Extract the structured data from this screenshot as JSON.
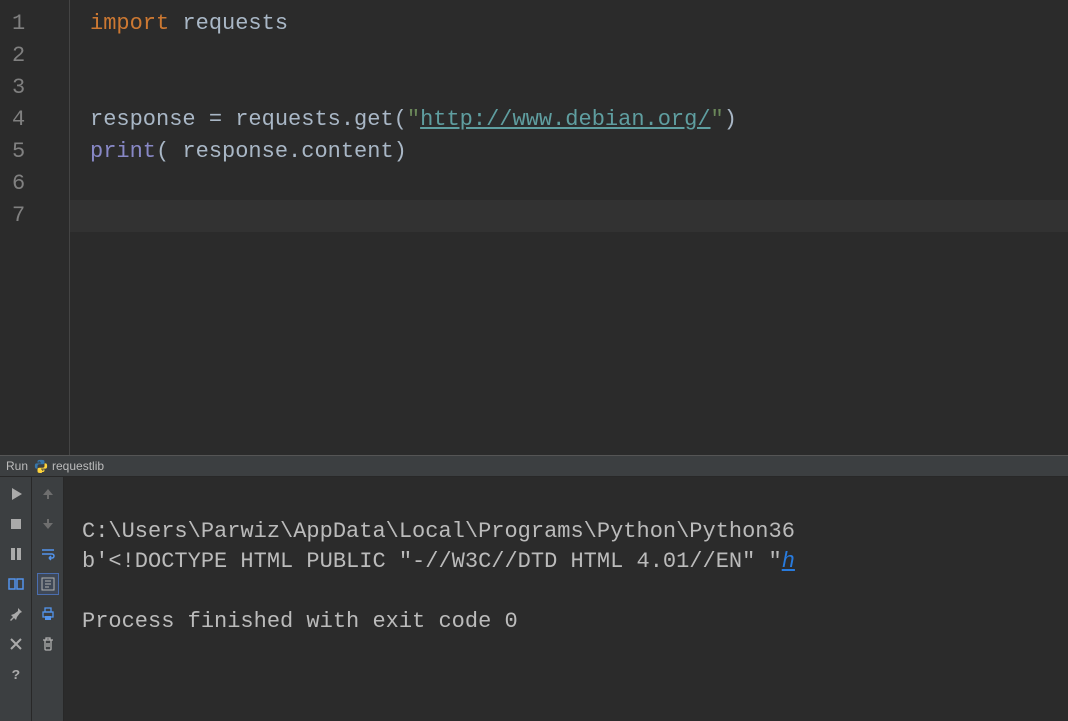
{
  "editor": {
    "line_numbers": [
      "1",
      "2",
      "3",
      "4",
      "5",
      "6",
      "7"
    ],
    "lines": {
      "l1_kw": "import",
      "l1_mod": " requests",
      "l4_var": "response ",
      "l4_eq": "=",
      "l4_call": " requests.get(",
      "l4_q1": "\"",
      "l4_url": "http://www.debian.org/",
      "l4_q2": "\"",
      "l4_close": ")",
      "l5_fn": "print",
      "l5_open": "( ",
      "l5_arg": "response.content)",
      "current_line_index": 6
    }
  },
  "run_panel": {
    "label": "Run",
    "config": "requestlib"
  },
  "console": {
    "line1": "C:\\Users\\Parwiz\\AppData\\Local\\Programs\\Python\\Python36",
    "line2_a": "b'<!DOCTYPE HTML PUBLIC \"-//W3C//DTD HTML 4.01//EN\" \"",
    "line2_link": "h",
    "line3": "Process finished with exit code 0"
  }
}
